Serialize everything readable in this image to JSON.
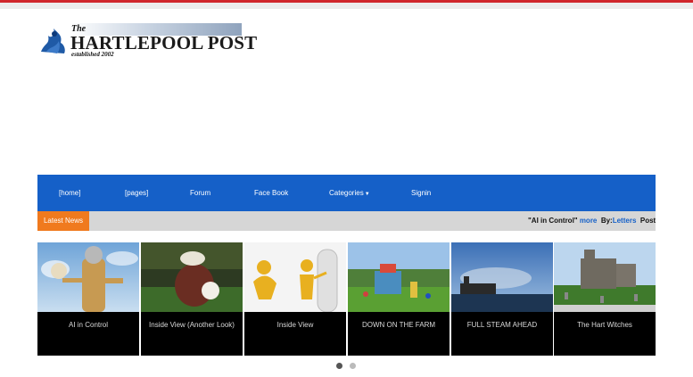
{
  "logo": {
    "the": "The",
    "name": "HARTLEPOOL POST",
    "established": "established 2002"
  },
  "nav": {
    "items": [
      {
        "label": "[home]"
      },
      {
        "label": "[pages]"
      },
      {
        "label": "Forum"
      },
      {
        "label": "Face Book"
      },
      {
        "label": "Categories"
      },
      {
        "label": "Signin"
      }
    ]
  },
  "ticker": {
    "label": "Latest News",
    "headline": "\"AI in Control\"",
    "more": "more",
    "by": "By:",
    "author": "Letters",
    "tail": "Post"
  },
  "carousel": {
    "cards": [
      {
        "caption": "AI in Control"
      },
      {
        "caption": "Inside View (Another Look)"
      },
      {
        "caption": "Inside View"
      },
      {
        "caption": "DOWN ON THE FARM"
      },
      {
        "caption": "FULL STEAM AHEAD"
      },
      {
        "caption": "The Hart Witches"
      }
    ],
    "active_page": 1,
    "page_count": 2
  },
  "colors": {
    "nav_bg": "#1560c8",
    "ticker_label_bg": "#f07a1e",
    "top_stripe": "#d0262c"
  }
}
